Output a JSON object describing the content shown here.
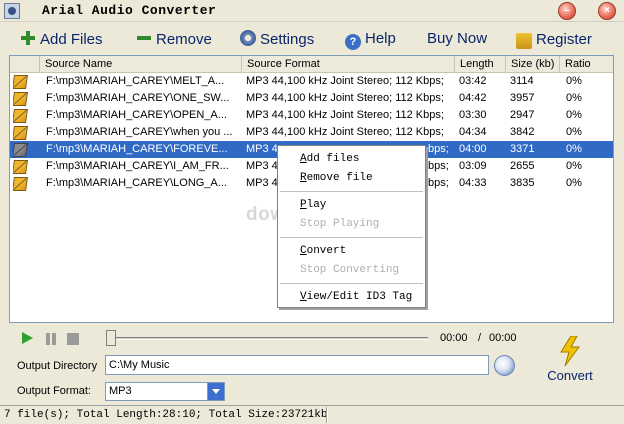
{
  "window": {
    "title": "Arial Audio Converter"
  },
  "toolbar": {
    "add_files": "Add Files",
    "remove": "Remove",
    "settings": "Settings",
    "help": "Help",
    "buy_now": "Buy Now",
    "register": "Register"
  },
  "columns": [
    "Source Name",
    "Source Format",
    "Length",
    "Size (kb)",
    "Ratio"
  ],
  "rows": [
    {
      "name": "F:\\mp3\\MARIAH_CAREY\\MELT_A...",
      "format": "MP3  44,100 kHz Joint Stereo;  112 Kbps;",
      "length": "03:42",
      "size": "3114",
      "ratio": "0%"
    },
    {
      "name": "F:\\mp3\\MARIAH_CAREY\\ONE_SW...",
      "format": "MP3  44,100 kHz Joint Stereo;  112 Kbps;",
      "length": "04:42",
      "size": "3957",
      "ratio": "0%"
    },
    {
      "name": "F:\\mp3\\MARIAH_CAREY\\OPEN_A...",
      "format": "MP3  44,100 kHz Joint Stereo;  112 Kbps;",
      "length": "03:30",
      "size": "2947",
      "ratio": "0%"
    },
    {
      "name": "F:\\mp3\\MARIAH_CAREY\\when you ...",
      "format": "MP3  44,100 kHz Joint Stereo;  112 Kbps;",
      "length": "04:34",
      "size": "3842",
      "ratio": "0%"
    },
    {
      "name": "F:\\mp3\\MARIAH_CAREY\\FOREVE...",
      "format": "MP3  4",
      "format_tail": "bps;",
      "length": "04:00",
      "size": "3371",
      "ratio": "0%",
      "selected": true
    },
    {
      "name": "F:\\mp3\\MARIAH_CAREY\\I_AM_FR...",
      "format": "MP3  4",
      "format_tail": "bps;",
      "length": "03:09",
      "size": "2655",
      "ratio": "0%"
    },
    {
      "name": "F:\\mp3\\MARIAH_CAREY\\LONG_A...",
      "format": "MP3  4",
      "format_tail": "bps;",
      "length": "04:33",
      "size": "3835",
      "ratio": "0%"
    }
  ],
  "watermark": "download",
  "context_menu": {
    "add_files": {
      "key": "A",
      "rest": "dd files"
    },
    "remove_file": {
      "key": "R",
      "rest": "emove file"
    },
    "play": {
      "key": "P",
      "rest": "lay"
    },
    "stop_playing": "Stop Playing",
    "convert": {
      "key": "C",
      "rest": "onvert"
    },
    "stop_converting": "Stop Converting",
    "view_edit": {
      "key": "V",
      "rest": "iew/Edit ID3 Tag"
    }
  },
  "player": {
    "current_time": "00:00",
    "separator": "/",
    "total_time": "00:00",
    "position": 0
  },
  "output": {
    "directory_label": "Output Directory",
    "directory_value": "C:\\My Music",
    "format_label": "Output Format:",
    "format_value": "MP3"
  },
  "convert_button": "Convert",
  "status": "7 file(s); Total Length:28:10; Total Size:23721kb",
  "colors": {
    "selection": "#316ac5",
    "accent_text": "#0a246a",
    "play_green": "#2ea22e"
  },
  "icons": [
    "app-icon",
    "plus-icon",
    "minus-icon",
    "gear-icon",
    "help-icon",
    "lock-icon",
    "audio-file-icon",
    "play-icon",
    "pause-icon",
    "stop-icon",
    "browse-icon",
    "dropdown-arrow-icon",
    "lightning-bolt-icon"
  ]
}
